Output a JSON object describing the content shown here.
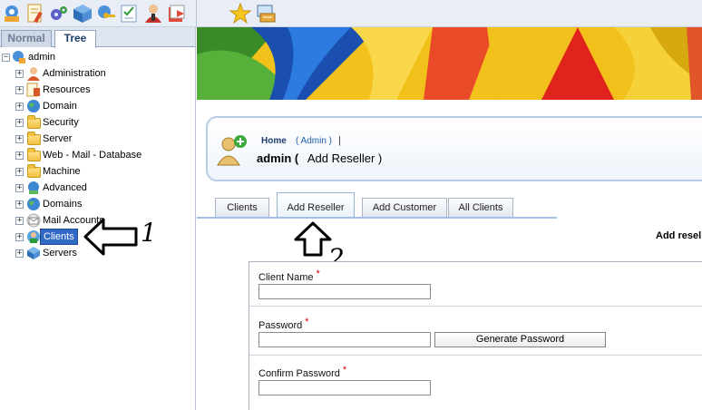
{
  "toolbar": {
    "icons": [
      "network-settings-icon",
      "document-edit-icon",
      "gears-icon",
      "cube-icon",
      "network-key-icon",
      "checklist-icon",
      "user-group-icon",
      "exit-icon",
      "favorites-star-icon",
      "printer-monitor-icon"
    ]
  },
  "left_panel": {
    "tabs": [
      {
        "label": "Normal",
        "active": false
      },
      {
        "label": "Tree",
        "active": true
      }
    ],
    "tree": {
      "root": "admin",
      "items": [
        {
          "label": "Administration",
          "icon": "admin-user-icon"
        },
        {
          "label": "Resources",
          "icon": "resources-icon"
        },
        {
          "label": "Domain",
          "icon": "globe-icon"
        },
        {
          "label": "Security",
          "icon": "folder-icon"
        },
        {
          "label": "Server",
          "icon": "folder-icon"
        },
        {
          "label": "Web - Mail - Database",
          "icon": "folder-icon"
        },
        {
          "label": "Machine",
          "icon": "folder-icon"
        },
        {
          "label": "Advanced",
          "icon": "network-icon"
        },
        {
          "label": "Domains",
          "icon": "globe-icon"
        },
        {
          "label": "Mail Accounts",
          "icon": "mail-icon"
        },
        {
          "label": "Clients",
          "icon": "clients-icon",
          "selected": true
        },
        {
          "label": "Servers",
          "icon": "server-cube-icon"
        }
      ]
    }
  },
  "annotations": {
    "arrow1_label": "1",
    "arrow2_label": "2"
  },
  "header": {
    "breadcrumb_home": "Home",
    "breadcrumb_admin": "( Admin )",
    "breadcrumb_sep": "|",
    "title_user": "admin (",
    "title_page": "Add Reseller )"
  },
  "content_tabs": [
    {
      "label": "Clients",
      "active": false
    },
    {
      "label": "Add Reseller",
      "active": true
    },
    {
      "label": "Add Customer",
      "active": false
    },
    {
      "label": "All Clients",
      "active": false
    }
  ],
  "section_heading": "Add resel",
  "form": {
    "client_name_label": "Client Name",
    "password_label": "Password",
    "confirm_password_label": "Confirm Password",
    "required_mark": "*",
    "client_name_value": "",
    "password_value": "",
    "confirm_password_value": "",
    "generate_password_label": "Generate Password"
  },
  "colors": {
    "selected_bg": "#316ac5",
    "required": "#dd0000",
    "tab_line": "#9fc3e8",
    "title_text": "#1c3e6e"
  }
}
